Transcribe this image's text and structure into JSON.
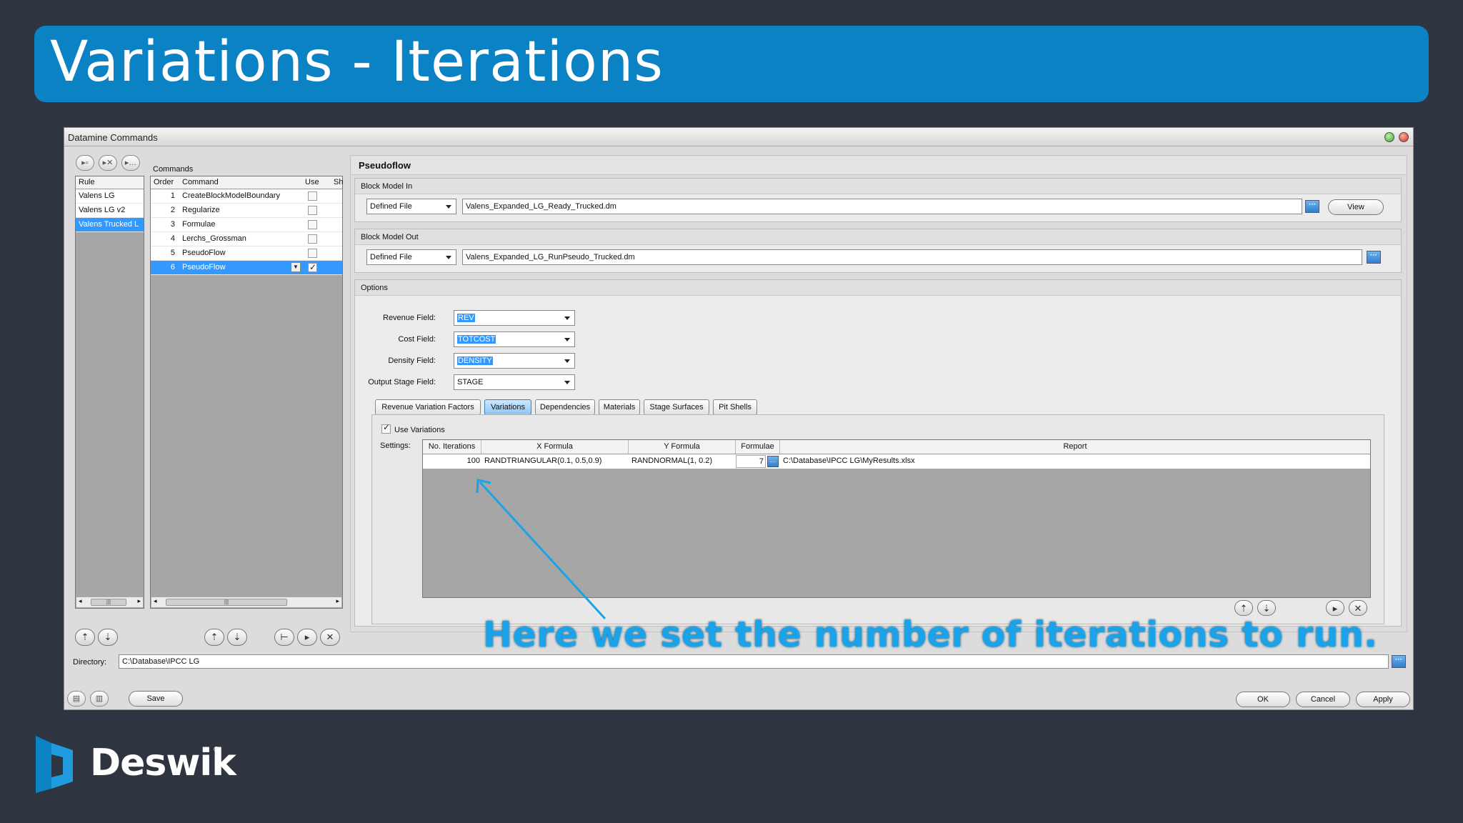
{
  "slide": {
    "title": "Variations - Iterations",
    "caption": "Here we set the number of iterations to run.",
    "logo_text": "Deswik",
    "logo_reg": "®"
  },
  "window": {
    "title": "Datamine Commands"
  },
  "rules": {
    "header": "Rule",
    "items": [
      "Valens LG",
      "Valens LG v2",
      "Valens Trucked L"
    ],
    "selected_index": 2
  },
  "commands": {
    "label": "Commands",
    "headers": {
      "order": "Order",
      "command": "Command",
      "use": "Use",
      "sh": "Sh"
    },
    "rows": [
      {
        "order": "1",
        "command": "CreateBlockModelBoundary",
        "use": false
      },
      {
        "order": "2",
        "command": "Regularize",
        "use": false
      },
      {
        "order": "3",
        "command": "Formulae",
        "use": false
      },
      {
        "order": "4",
        "command": "Lerchs_Grossman",
        "use": false
      },
      {
        "order": "5",
        "command": "PseudoFlow",
        "use": false
      },
      {
        "order": "6",
        "command": "PseudoFlow",
        "use": true
      }
    ]
  },
  "panel": {
    "title": "Pseudoflow",
    "block_in": {
      "label": "Block Model In",
      "mode": "Defined File",
      "file": "Valens_Expanded_LG_Ready_Trucked.dm",
      "view_label": "View"
    },
    "block_out": {
      "label": "Block Model Out",
      "mode": "Defined File",
      "file": "Valens_Expanded_LG_RunPseudo_Trucked.dm"
    },
    "options": {
      "label": "Options",
      "revenue_label": "Revenue Field:",
      "revenue_value": "REV",
      "cost_label": "Cost Field:",
      "cost_value": "TOTCOST",
      "density_label": "Density Field:",
      "density_value": "DENSITY",
      "stage_label": "Output Stage Field:",
      "stage_value": "STAGE"
    },
    "tabs": [
      "Revenue Variation Factors",
      "Variations",
      "Dependencies",
      "Materials",
      "Stage Surfaces",
      "Pit Shells"
    ],
    "active_tab": "Variations",
    "variations": {
      "use_label": "Use Variations",
      "use_checked": true,
      "settings_label": "Settings:",
      "headers": {
        "iterations": "No. Iterations",
        "x": "X Formula",
        "y": "Y Formula",
        "formulae": "Formulae",
        "report": "Report"
      },
      "row": {
        "iterations": "100",
        "x": "RANDTRIANGULAR(0.1, 0.5,0.9)",
        "y": "RANDNORMAL(1, 0.2)",
        "formulae": "7",
        "report": "C:\\Database\\IPCC LG\\MyResults.xlsx"
      }
    }
  },
  "footer": {
    "directory_label": "Directory:",
    "directory_value": "C:\\Database\\IPCC LG",
    "save_label": "Save",
    "ok_label": "OK",
    "cancel_label": "Cancel",
    "apply_label": "Apply"
  },
  "colors": {
    "banner": "#0b82c4",
    "background": "#2f3441",
    "caption": "#1aa3e8",
    "selection": "#3399ff"
  }
}
